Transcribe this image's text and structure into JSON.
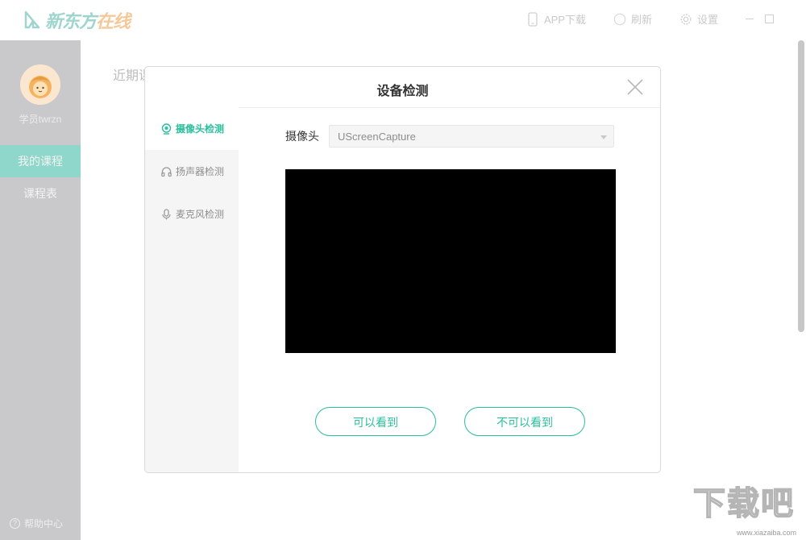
{
  "header": {
    "logo": {
      "brand_main": "新东方",
      "brand_accent": "在线"
    },
    "toolbar": [
      {
        "label": "APP下载",
        "icon": "phone-icon"
      },
      {
        "label": "刷新",
        "icon": "refresh-icon"
      },
      {
        "label": "设置",
        "icon": "gear-icon"
      }
    ]
  },
  "sidebar": {
    "username": "学员twrzn",
    "items": [
      {
        "label": "我的课程",
        "active": true
      },
      {
        "label": "课程表",
        "active": false
      }
    ],
    "help_label": "帮助中心"
  },
  "main": {
    "title": "近期课"
  },
  "modal": {
    "title": "设备检测",
    "tabs": [
      {
        "label": "摄像头检测",
        "icon": "camera-icon",
        "active": true
      },
      {
        "label": "扬声器检测",
        "icon": "headphones-icon",
        "active": false
      },
      {
        "label": "麦克风检测",
        "icon": "microphone-icon",
        "active": false
      }
    ],
    "camera_label": "摄像头",
    "camera_value": "UScreenCapture",
    "btn_can_see": "可以看到",
    "btn_cannot_see": "不可以看到"
  },
  "watermark": {
    "text": "下载吧",
    "url": "www.xiazaiba.com"
  },
  "colors": {
    "accent": "#2bbf9d",
    "sidebar": "#c9c9cc",
    "active_nav": "#8fd7cb"
  }
}
